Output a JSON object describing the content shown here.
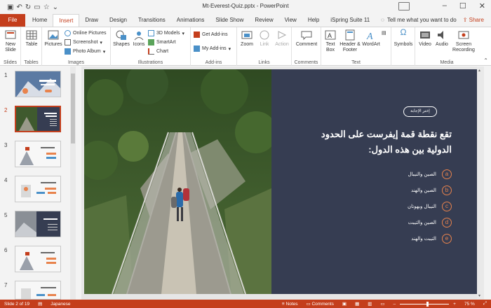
{
  "window": {
    "title": "Mt-Everest-Quiz.pptx",
    "app": "PowerPoint",
    "share": "Share"
  },
  "tabs": [
    "File",
    "Home",
    "Insert",
    "Draw",
    "Design",
    "Transitions",
    "Animations",
    "Slide Show",
    "Review",
    "View",
    "Help",
    "iSpring Suite 11"
  ],
  "tell_me": "Tell me what you want to do",
  "ribbon": {
    "slides": {
      "new_slide": "New Slide",
      "label": "Slides"
    },
    "tables": {
      "table": "Table",
      "label": "Tables"
    },
    "images": {
      "pictures": "Pictures",
      "online": "Online Pictures",
      "screenshot": "Screenshot",
      "album": "Photo Album",
      "label": "Images"
    },
    "illustrations": {
      "shapes": "Shapes",
      "icons": "Icons",
      "models": "3D Models",
      "smartart": "SmartArt",
      "chart": "Chart",
      "label": "Illustrations"
    },
    "addins": {
      "get": "Get Add-ins",
      "my": "My Add-ins",
      "label": "Add-ins"
    },
    "links": {
      "zoom": "Zoom",
      "link": "Link",
      "action": "Action",
      "label": "Links"
    },
    "comments": {
      "comment": "Comment",
      "label": "Comments"
    },
    "text": {
      "textbox": "Text Box",
      "header": "Header & Footer",
      "wordart": "WordArt",
      "label": "Text"
    },
    "symbols": {
      "symbols": "Symbols"
    },
    "media": {
      "video": "Video",
      "audio": "Audio",
      "screen": "Screen Recording",
      "label": "Media"
    }
  },
  "slide_numbers": [
    "1",
    "2",
    "3",
    "4",
    "5",
    "6",
    "7"
  ],
  "slide": {
    "choose_answer": "إختر الإجابة",
    "question": "تقع نقطة قمة إيفرست على الحدود الدولية بين هذه الدول:",
    "options": [
      {
        "letter": "a",
        "text": "الصين والنيبال"
      },
      {
        "letter": "b",
        "text": "الصين والهند"
      },
      {
        "letter": "c",
        "text": "النيبال وبهوتان"
      },
      {
        "letter": "d",
        "text": "الصين والتيبت"
      },
      {
        "letter": "e",
        "text": "التيبت والهند"
      }
    ]
  },
  "status": {
    "slide": "Slide 2 of 19",
    "language": "Japanese",
    "notes": "Notes",
    "comments": "Comments",
    "zoom": "75 %"
  },
  "colors": {
    "accent": "#c43e1c",
    "panel": "#363d52",
    "option": "#e8834d"
  }
}
